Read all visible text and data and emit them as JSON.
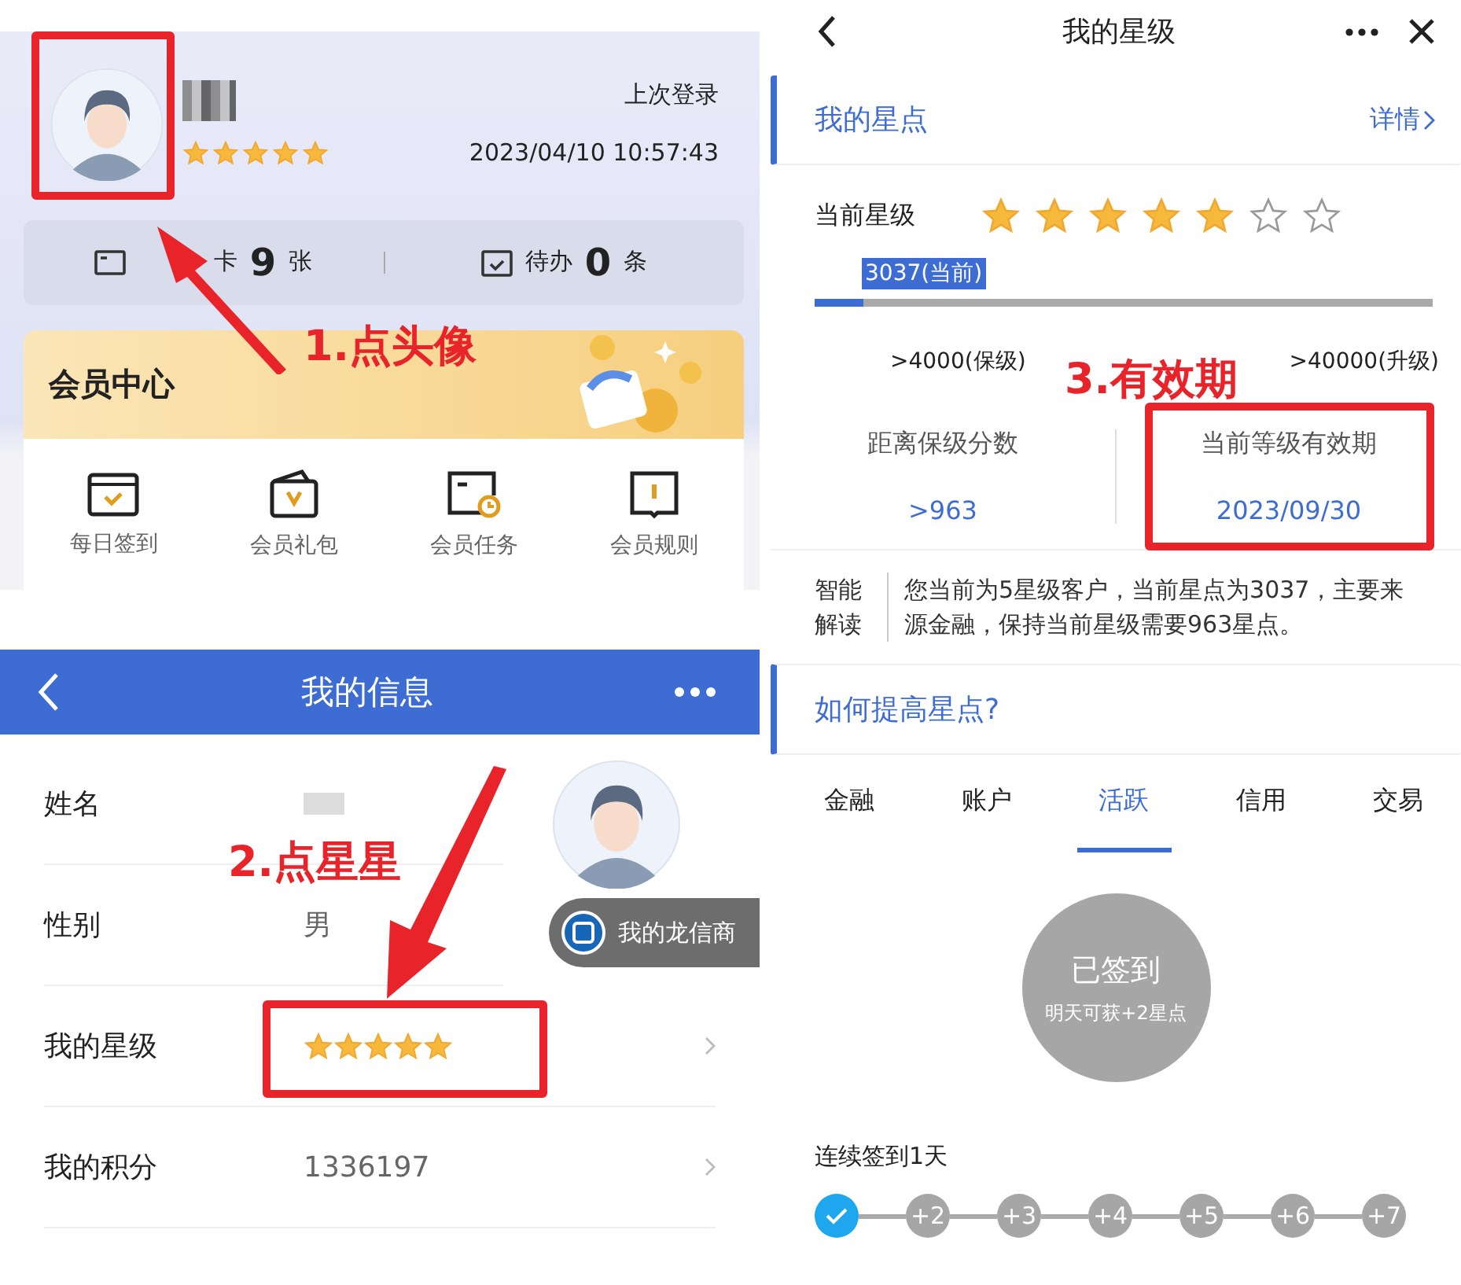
{
  "profile_panel": {
    "stars": 5,
    "last_login_label": "上次登录",
    "last_login_time": "2023/04/10 10:57:43",
    "summary": [
      {
        "kind": "card",
        "label": "卡",
        "count": "9",
        "unit": "张"
      },
      {
        "kind": "todo",
        "label": "待办",
        "count": "0",
        "unit": "条"
      }
    ],
    "member_center": {
      "title": "会员中心",
      "actions": [
        {
          "kind": "checkin",
          "label": "每日签到"
        },
        {
          "kind": "gift",
          "label": "会员礼包"
        },
        {
          "kind": "task",
          "label": "会员任务"
        },
        {
          "kind": "rules",
          "label": "会员规则"
        }
      ]
    }
  },
  "info_screen": {
    "title": "我的信息",
    "rows": [
      {
        "kind": "blurred",
        "label": "姓名"
      },
      {
        "kind": "text",
        "label": "性别",
        "value": "男"
      },
      {
        "kind": "stars",
        "label": "我的星级",
        "stars": 5
      },
      {
        "kind": "text",
        "label": "我的积分",
        "value": "1336197"
      }
    ],
    "badge": "我的龙信商"
  },
  "star_screen": {
    "title": "我的星级",
    "section_title": "我的星点",
    "details_link": "详情",
    "level_label": "当前星级",
    "level_stars": [
      {
        "filled": true
      },
      {
        "filled": true
      },
      {
        "filled": true
      },
      {
        "filled": true
      },
      {
        "filled": true
      },
      {
        "filled": false
      },
      {
        "filled": false
      }
    ],
    "current_points": "3037(当前)",
    "progress": {
      "level": 0.08
    },
    "keep_threshold": ">4000(保级)",
    "upgrade_threshold": ">40000(升级)",
    "stats": [
      {
        "label": "距离保级分数",
        "value": ">963"
      },
      {
        "label": "当前等级有效期",
        "value": "2023/09/30"
      }
    ],
    "insight_label": "智能解读",
    "insight_text": "您当前为5星级客户，当前星点为3037，主要来源金融，保持当前星级需要963星点。",
    "how_title": "如何提高星点?",
    "tabs": [
      {
        "label": "金融",
        "selected": false
      },
      {
        "label": "账户",
        "selected": false
      },
      {
        "label": "活跃",
        "selected": true
      },
      {
        "label": "信用",
        "selected": false
      },
      {
        "label": "交易",
        "selected": false
      }
    ],
    "checkin_title": "已签到",
    "checkin_subtitle": "明天可获+2星点",
    "streak_label": "连续签到1天",
    "streak_days": [
      {
        "done": true
      },
      {
        "label": "+2",
        "done": false
      },
      {
        "label": "+3",
        "done": false
      },
      {
        "label": "+4",
        "done": false
      },
      {
        "label": "+5",
        "done": false
      },
      {
        "label": "+6",
        "done": false
      },
      {
        "label": "+7",
        "done": false
      }
    ]
  },
  "annotations": [
    {
      "text": "1.点头像"
    },
    {
      "text": "2.点星星"
    },
    {
      "text": "3.有效期"
    }
  ]
}
